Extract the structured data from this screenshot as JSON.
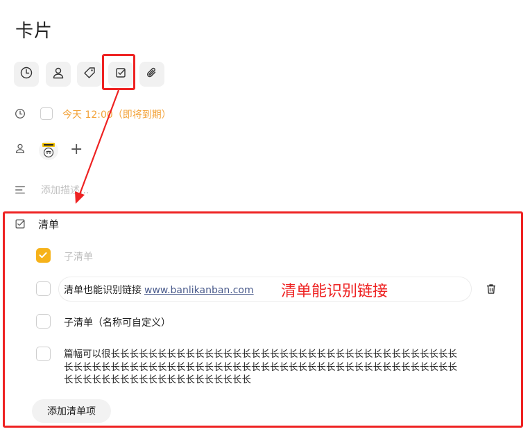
{
  "card": {
    "title": "卡片"
  },
  "toolbar": {
    "buttons": [
      {
        "icon": "clock-icon"
      },
      {
        "icon": "user-icon"
      },
      {
        "icon": "tag-icon"
      },
      {
        "icon": "checklist-icon"
      },
      {
        "icon": "paperclip-icon"
      }
    ]
  },
  "due": {
    "text": "今天 12:00（即将到期）",
    "color": "#f3a33a"
  },
  "members": {
    "add_label": "+"
  },
  "description": {
    "placeholder": "添加描述..."
  },
  "checklist": {
    "title": "清单",
    "items": [
      {
        "checked": true,
        "text": "子清单"
      },
      {
        "checked": false,
        "text": "清单也能识别链接",
        "link": "www.banlikanban.com"
      },
      {
        "checked": false,
        "text": "子清单（名称可自定义）"
      },
      {
        "checked": false,
        "text": "篇幅可以很长长长长长长长长长长长长长长长长长长长长长长长长长长长长长长长长长长长长长长长长长长长长长长长长长长长长长长长长长长长长长长长长长长长长长长长长长长长长长长长长长长长长长长长长长长长长长长长长长长长"
      }
    ],
    "add_item_label": "添加清单项"
  },
  "annotation": {
    "label": "清单能识别链接",
    "color": "#ee2222"
  },
  "colors": {
    "accent": "#f6b21a",
    "due": "#f3a33a",
    "annotation": "#ee2222"
  }
}
